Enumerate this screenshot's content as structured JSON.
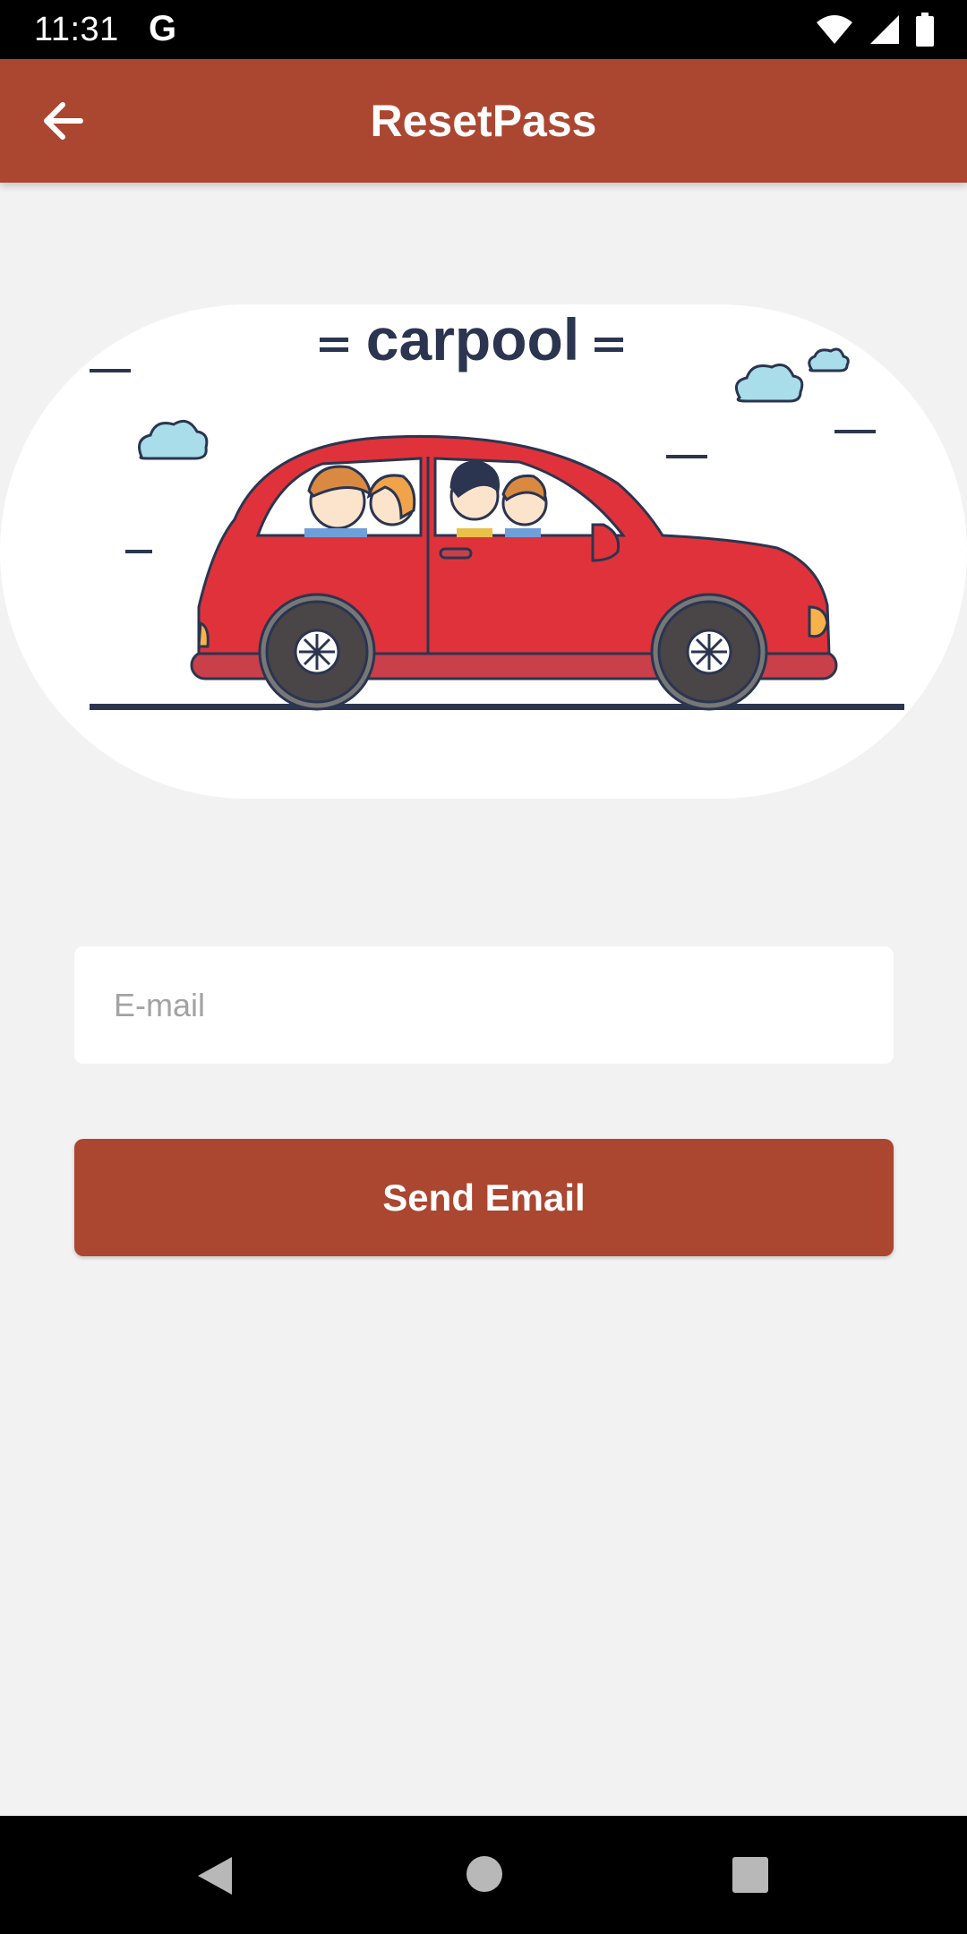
{
  "status_bar": {
    "time": "11:31",
    "g_label": "G"
  },
  "app_bar": {
    "title": "ResetPass"
  },
  "hero": {
    "logo_text": "carpool"
  },
  "form": {
    "email_placeholder": "E-mail",
    "email_value": "",
    "send_label": "Send Email"
  },
  "colors": {
    "primary": "#ab4631",
    "background": "#f2f2f2",
    "car_red": "#e0323a",
    "outline": "#2b3550"
  }
}
